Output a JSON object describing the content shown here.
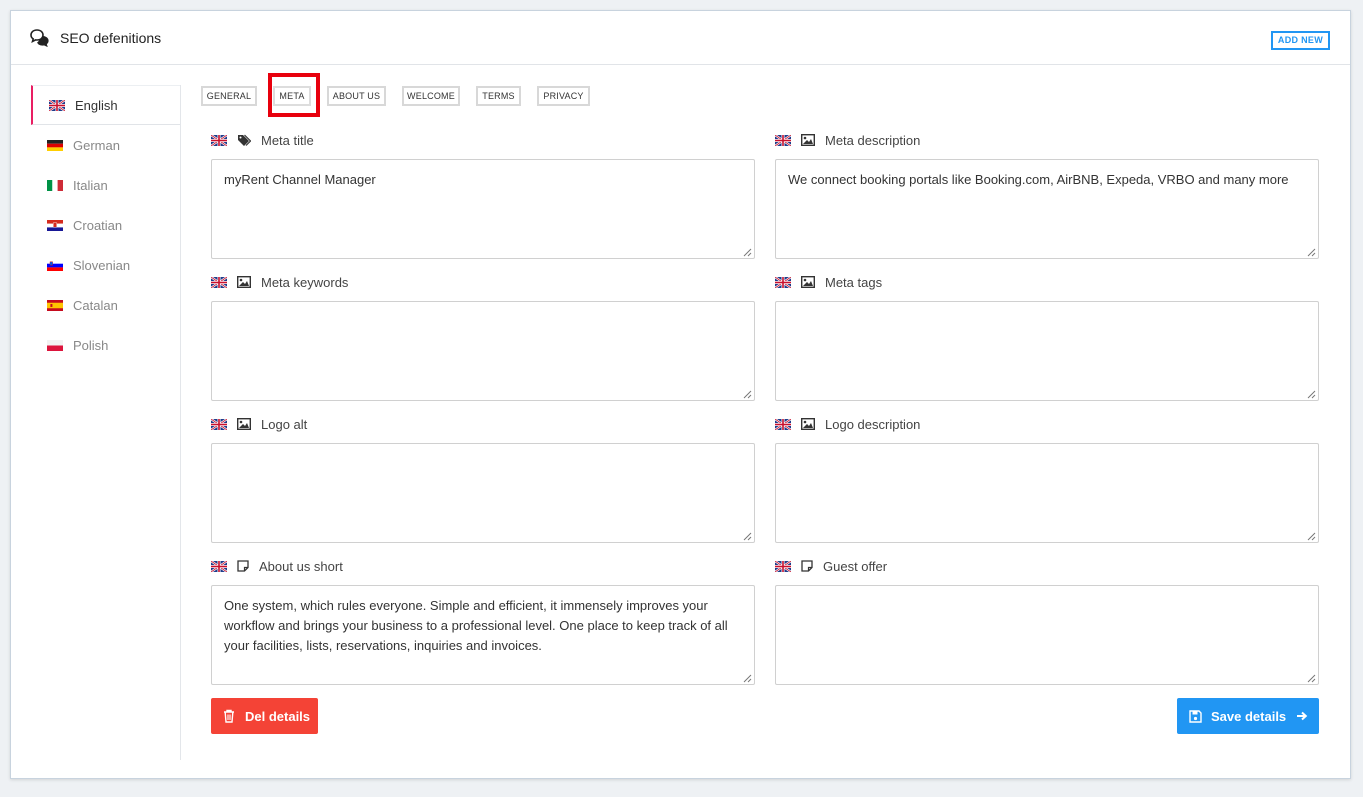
{
  "header": {
    "title": "SEO defenitions",
    "icon": "chat-bubbles-icon",
    "add_new_label": "ADD NEW"
  },
  "sidebar": {
    "items": [
      {
        "label": "English",
        "flag": "uk-flag-icon",
        "active": true
      },
      {
        "label": "German",
        "flag": "de-flag-icon"
      },
      {
        "label": "Italian",
        "flag": "it-flag-icon"
      },
      {
        "label": "Croatian",
        "flag": "hr-flag-icon"
      },
      {
        "label": "Slovenian",
        "flag": "si-flag-icon"
      },
      {
        "label": "Catalan",
        "flag": "es-flag-icon"
      },
      {
        "label": "Polish",
        "flag": "pl-flag-icon"
      }
    ]
  },
  "tabs": [
    {
      "label": "GENERAL"
    },
    {
      "label": "META",
      "active": true
    },
    {
      "label": "ABOUT US"
    },
    {
      "label": "WELCOME"
    },
    {
      "label": "TERMS"
    },
    {
      "label": "PRIVACY"
    }
  ],
  "fields": {
    "meta_title": {
      "label": "Meta title",
      "icon": "tags-icon",
      "value": "myRent Channel Manager"
    },
    "meta_description": {
      "label": "Meta description",
      "icon": "image-icon",
      "value": "We connect booking portals like Booking.com, AirBNB, Expeda, VRBO and many more"
    },
    "meta_keywords": {
      "label": "Meta keywords",
      "icon": "image-icon",
      "value": ""
    },
    "meta_tags": {
      "label": "Meta tags",
      "icon": "image-icon",
      "value": ""
    },
    "logo_alt": {
      "label": "Logo alt",
      "icon": "image-icon",
      "value": ""
    },
    "logo_description": {
      "label": "Logo description",
      "icon": "image-icon",
      "value": ""
    },
    "about_us_short": {
      "label": "About us short",
      "icon": "note-icon",
      "value": "One system, which rules everyone. Simple and efficient, it immensely improves your workflow and brings your business to a professional level. One place to keep track of all your facilities, lists, reservations, inquiries and invoices."
    },
    "guest_offer": {
      "label": "Guest offer",
      "icon": "note-icon",
      "value": ""
    }
  },
  "actions": {
    "delete_label": "Del details",
    "save_label": "Save details"
  },
  "colors": {
    "accent": "#2196f3",
    "danger": "#f44336",
    "active_marker": "#e91e63",
    "highlight": "#e8000d"
  }
}
